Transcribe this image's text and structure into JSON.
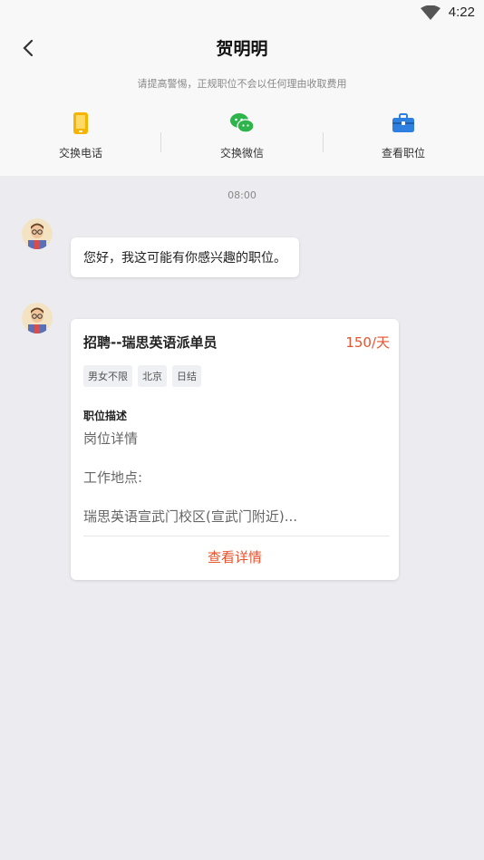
{
  "status_bar": {
    "time": "4:22",
    "wifi_icon": "wifi-icon"
  },
  "header": {
    "back_icon": "chevron-left-icon",
    "title": "贺明明",
    "warning": "请提高警惕，正规职位不会以任何理由收取费用"
  },
  "actions": [
    {
      "label": "交换电话",
      "icon": "phone-icon",
      "color": "#f5b400"
    },
    {
      "label": "交换微信",
      "icon": "wechat-icon",
      "color": "#2db44a"
    },
    {
      "label": "查看职位",
      "icon": "briefcase-icon",
      "color": "#2f7fe0"
    }
  ],
  "chat": {
    "time": "08:00",
    "greeting": "您好，我这可能有你感兴趣的职位。",
    "job_card": {
      "title": "招聘--瑞思英语派单员",
      "salary": "150/天",
      "tags": [
        "男女不限",
        "北京",
        "日结"
      ],
      "desc_heading": "职位描述",
      "desc_lines": [
        "岗位详情",
        "工作地点:",
        "瑞思英语宣武门校区(宣武门附近)..."
      ],
      "link_label": "查看详情"
    }
  }
}
